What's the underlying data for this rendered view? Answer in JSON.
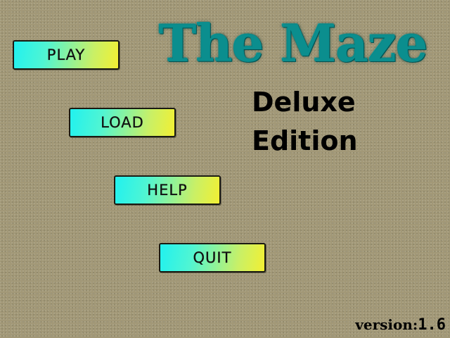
{
  "game": {
    "title": "The Maze",
    "subtitle_line1": "Deluxe",
    "subtitle_line2": "Edition"
  },
  "menu": {
    "play_label": "PLAY",
    "load_label": "LOAD",
    "help_label": "HELP",
    "quit_label": "QUIT"
  },
  "footer": {
    "version_label": "version:",
    "version_number": "1.6"
  },
  "colors": {
    "background": "#a29877",
    "title": "#0b8e8e",
    "button_gradient_start": "#21f1ef",
    "button_gradient_end": "#f2ef33"
  }
}
